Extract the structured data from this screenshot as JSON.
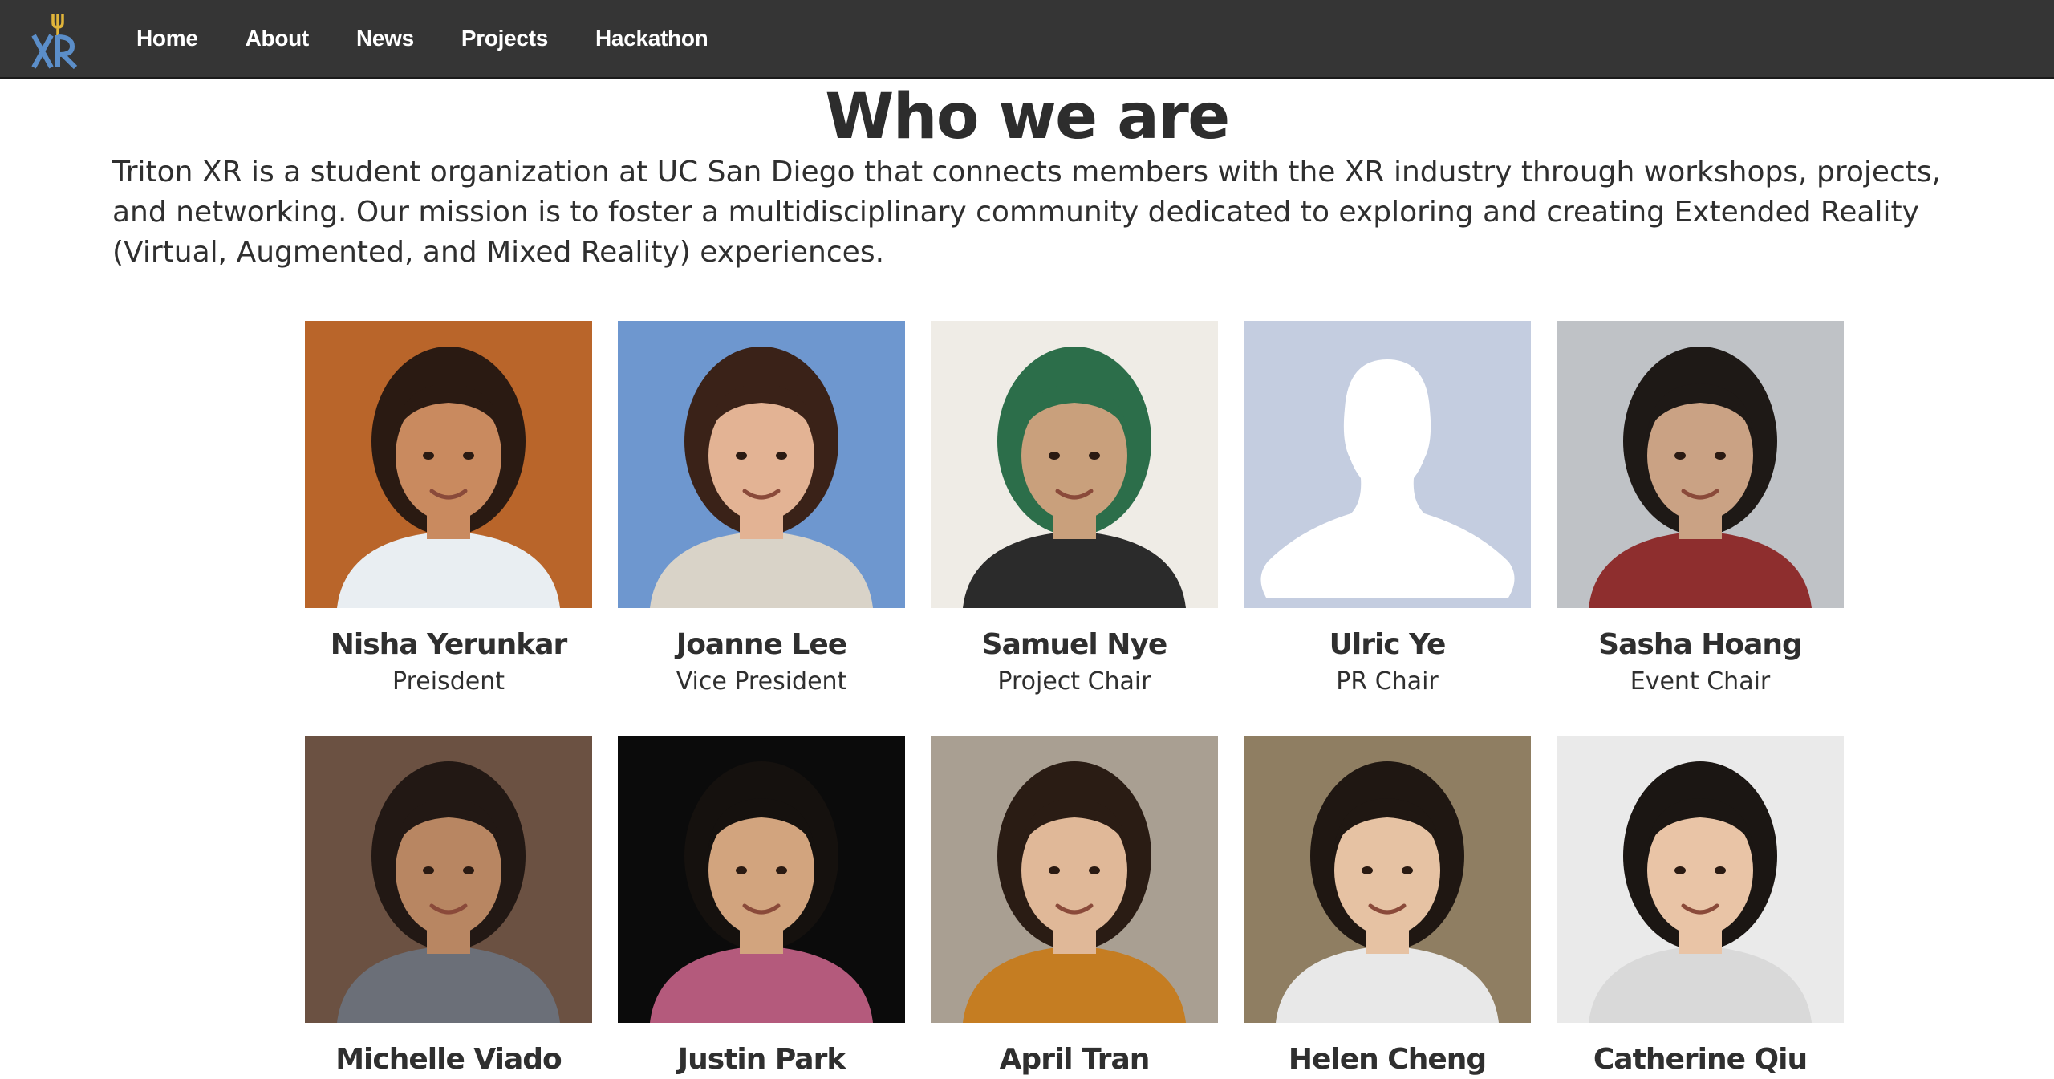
{
  "nav": {
    "logo_icon": "triton-xr-logo",
    "links": [
      "Home",
      "About",
      "News",
      "Projects",
      "Hackathon"
    ]
  },
  "page": {
    "title": "Who we are",
    "mission": "Triton XR is a student organization at UC San Diego that connects members with the XR industry through workshops, projects, and networking. Our mission is to foster a multidisciplinary community dedicated to exploring and creating Extended Reality (Virtual, Augmented, and Mixed Reality) experiences."
  },
  "team": [
    {
      "name": "Nisha Yerunkar",
      "role": "Preisdent",
      "bg": "#b9652a",
      "skin": "#c98a5f",
      "hair": "#2a1a12",
      "shirt": "#e9eef2"
    },
    {
      "name": "Joanne Lee",
      "role": "Vice President",
      "bg": "#6e97cf",
      "skin": "#e3b394",
      "hair": "#3a2218",
      "shirt": "#d9d3c8"
    },
    {
      "name": "Samuel Nye",
      "role": "Project Chair",
      "bg": "#efece6",
      "skin": "#c9a07c",
      "hair": "#2c6e4a",
      "shirt": "#2b2b2b"
    },
    {
      "name": "Ulric Ye",
      "role": "PR Chair",
      "bg": "#c4cde0",
      "skin": "#ffffff",
      "hair": "#ffffff",
      "shirt": "#ffffff"
    },
    {
      "name": "Sasha Hoang",
      "role": "Event Chair",
      "bg": "#bfc2c6",
      "skin": "#caa284",
      "hair": "#1e1916",
      "shirt": "#8e2e2e"
    },
    {
      "name": "Michelle Viado",
      "role": "",
      "bg": "#6b5142",
      "skin": "#b88662",
      "hair": "#221814",
      "shirt": "#6b6f78"
    },
    {
      "name": "Justin Park",
      "role": "",
      "bg": "#0b0b0b",
      "skin": "#d2a47e",
      "hair": "#15110e",
      "shirt": "#b45a7c"
    },
    {
      "name": "April Tran",
      "role": "",
      "bg": "#a99f92",
      "skin": "#e0b898",
      "hair": "#2a1c14",
      "shirt": "#c57d22"
    },
    {
      "name": "Helen Cheng",
      "role": "",
      "bg": "#8f7e62",
      "skin": "#e6c2a3",
      "hair": "#1f1712",
      "shirt": "#e8e8e8"
    },
    {
      "name": "Catherine Qiu",
      "role": "",
      "bg": "#eaeaea",
      "skin": "#e9c4a6",
      "hair": "#1b1613",
      "shirt": "#d9d9d9"
    }
  ]
}
